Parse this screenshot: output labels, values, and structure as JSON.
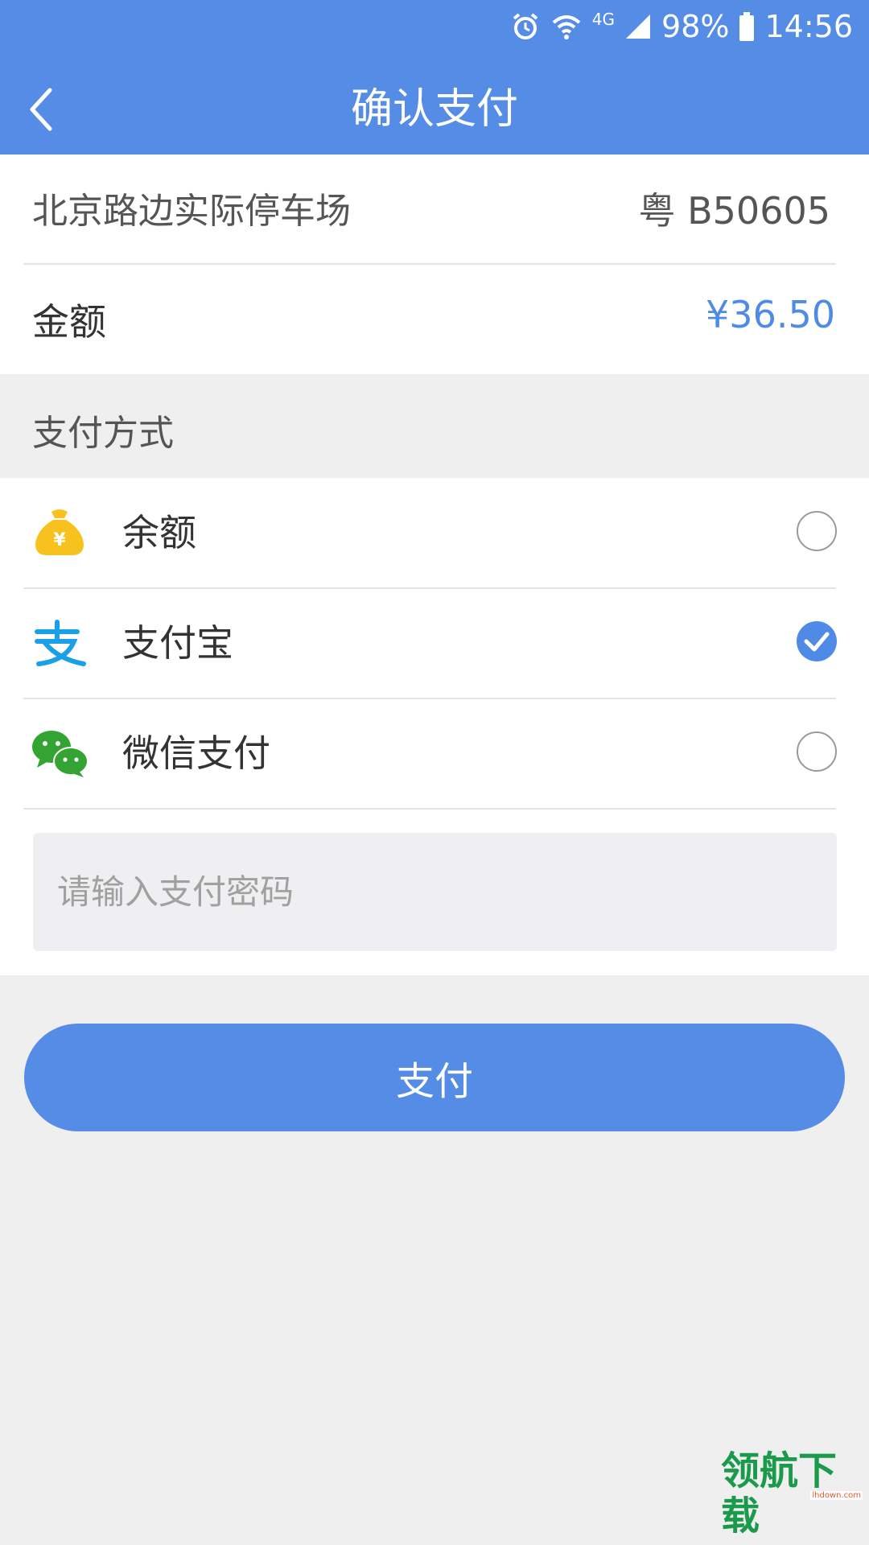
{
  "status_bar": {
    "network": "4G",
    "battery": "98%",
    "time": "14:56"
  },
  "nav": {
    "title": "确认支付"
  },
  "order": {
    "lot_name": "北京路边实际停车场",
    "plate": "粤 B50605",
    "amount_label": "金额",
    "amount_value": "¥36.50"
  },
  "payment": {
    "section_label": "支付方式",
    "methods": [
      {
        "label": "余额",
        "icon": "money-bag-icon",
        "selected": false
      },
      {
        "label": "支付宝",
        "icon": "alipay-icon",
        "selected": true
      },
      {
        "label": "微信支付",
        "icon": "wechat-icon",
        "selected": false
      }
    ],
    "password_placeholder": "请输入支付密码",
    "pay_label": "支付"
  },
  "watermark": {
    "text": "领航下载",
    "domain": "lhdown.com"
  },
  "colors": {
    "primary": "#558ce6",
    "amount": "#4f8be6",
    "background": "#efeff0",
    "alipay": "#1aa0e6",
    "wechat": "#33a334",
    "balance": "#f7c21e"
  }
}
